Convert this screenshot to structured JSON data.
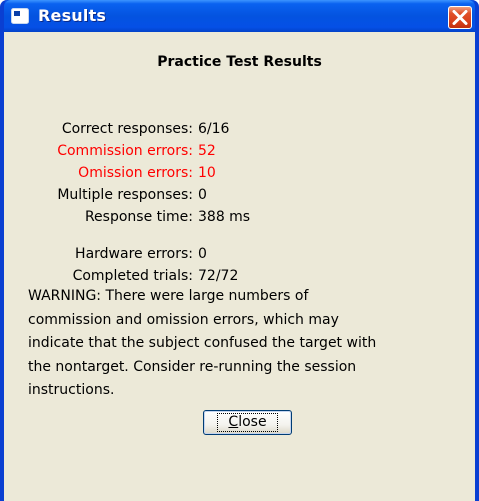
{
  "window": {
    "title": "Results",
    "close_icon": "close-icon"
  },
  "dialog": {
    "heading": "Practice Test Results",
    "stats": [
      {
        "label": "Correct responses:",
        "value": "6/16",
        "error": false
      },
      {
        "label": "Commission errors:",
        "value": "52",
        "error": true
      },
      {
        "label": "Omission errors:",
        "value": "10",
        "error": true
      },
      {
        "label": "Multiple responses:",
        "value": "0",
        "error": false
      },
      {
        "label": "Response time:",
        "value": "388 ms",
        "error": false
      },
      {
        "label": "Hardware errors:",
        "value": "0",
        "error": false
      },
      {
        "label": "Completed trials:",
        "value": "72/72",
        "error": false
      }
    ],
    "warning_lines": [
      "WARNING: There were large numbers of",
      "commission and omission errors, which may",
      "indicate that the subject confused the target with",
      "the nontarget. Consider re-running the session",
      "instructions."
    ],
    "close_button": {
      "mnemonic": "C",
      "rest": "lose"
    }
  },
  "colors": {
    "title_bar": "#0453e0",
    "client_bg": "#ece9d8",
    "error_text": "#ff0000",
    "close_button_red": "#d8401c"
  }
}
